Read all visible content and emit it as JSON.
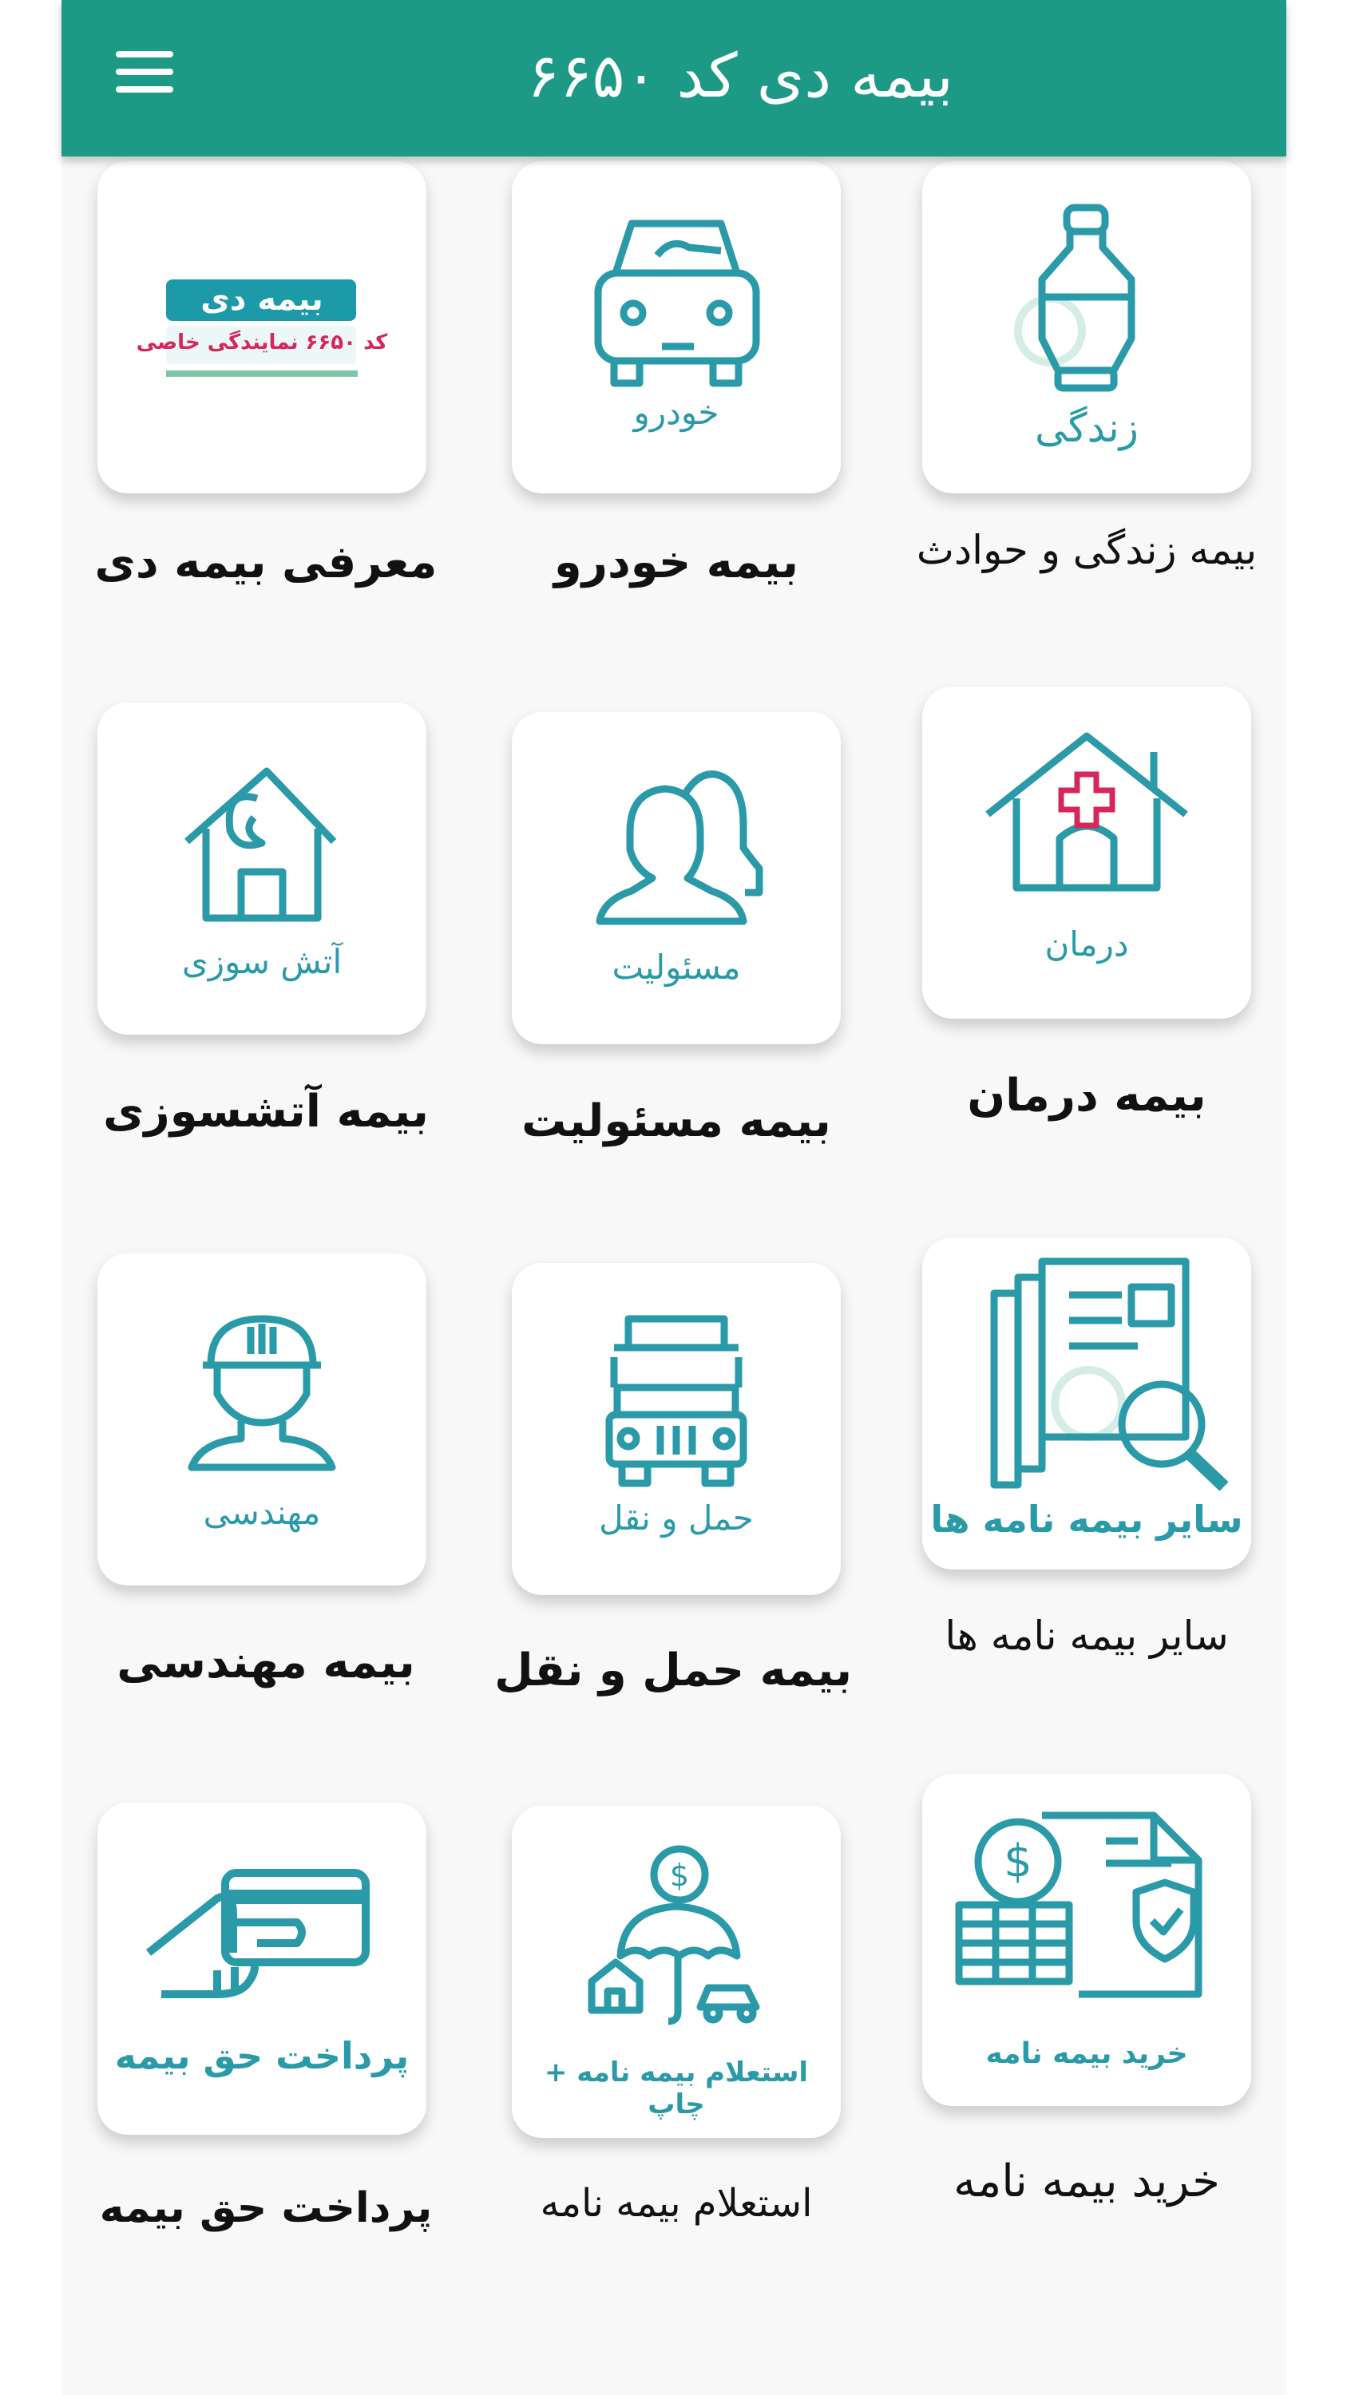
{
  "header": {
    "title": "بیمه دی کد ۶۶۵۰"
  },
  "colors": {
    "brand": "#1d9a85",
    "icon": "#2a9aa8",
    "accent_red": "#d6265a",
    "background": "#f8f8f8"
  },
  "tiles": [
    {
      "id": "life",
      "label": "بیمه زندگی و حوادث",
      "icon_text": "زندگی",
      "icon": "life-bottle-icon"
    },
    {
      "id": "car",
      "label": "بیمه خودرو",
      "icon_text": "خودرو",
      "icon": "car-icon"
    },
    {
      "id": "intro",
      "label": "معرفی بیمه دی",
      "icon_text": "بیمه دی",
      "icon_text2": "کد ۶۶۵۰ نمایندگی خاصی",
      "icon": "dey-logo"
    },
    {
      "id": "health",
      "label": "بیمه درمان",
      "icon_text": "درمان",
      "icon": "health-house-icon"
    },
    {
      "id": "liability",
      "label": "بیمه مسئولیت",
      "icon_text": "مسئولیت",
      "icon": "people-icon"
    },
    {
      "id": "fire",
      "label": "بیمه آتشسوزی",
      "icon_text": "آتش سوزی",
      "icon": "fire-house-icon"
    },
    {
      "id": "other",
      "label": "سایر بیمه نامه ها",
      "icon_text": "سایر بیمه نامه ها",
      "icon": "documents-search-icon"
    },
    {
      "id": "transport",
      "label": "بیمه حمل و نقل",
      "icon_text": "حمل و نقل",
      "icon": "truck-icon"
    },
    {
      "id": "engineering",
      "label": "بیمه مهندسی",
      "icon_text": "مهندسی",
      "icon": "engineer-helmet-icon"
    },
    {
      "id": "buy",
      "label": "خرید بیمه نامه",
      "icon_text": "خرید بیمه نامه",
      "icon": "buy-policy-icon"
    },
    {
      "id": "inquiry",
      "label": "استعلام بیمه نامه",
      "icon_text": "استعلام بیمه نامه + چاپ",
      "icon": "umbrella-money-icon"
    },
    {
      "id": "pay",
      "label": "پرداخت حق بیمه",
      "icon_text": "پرداخت حق بیمه",
      "icon": "card-payment-icon"
    }
  ]
}
